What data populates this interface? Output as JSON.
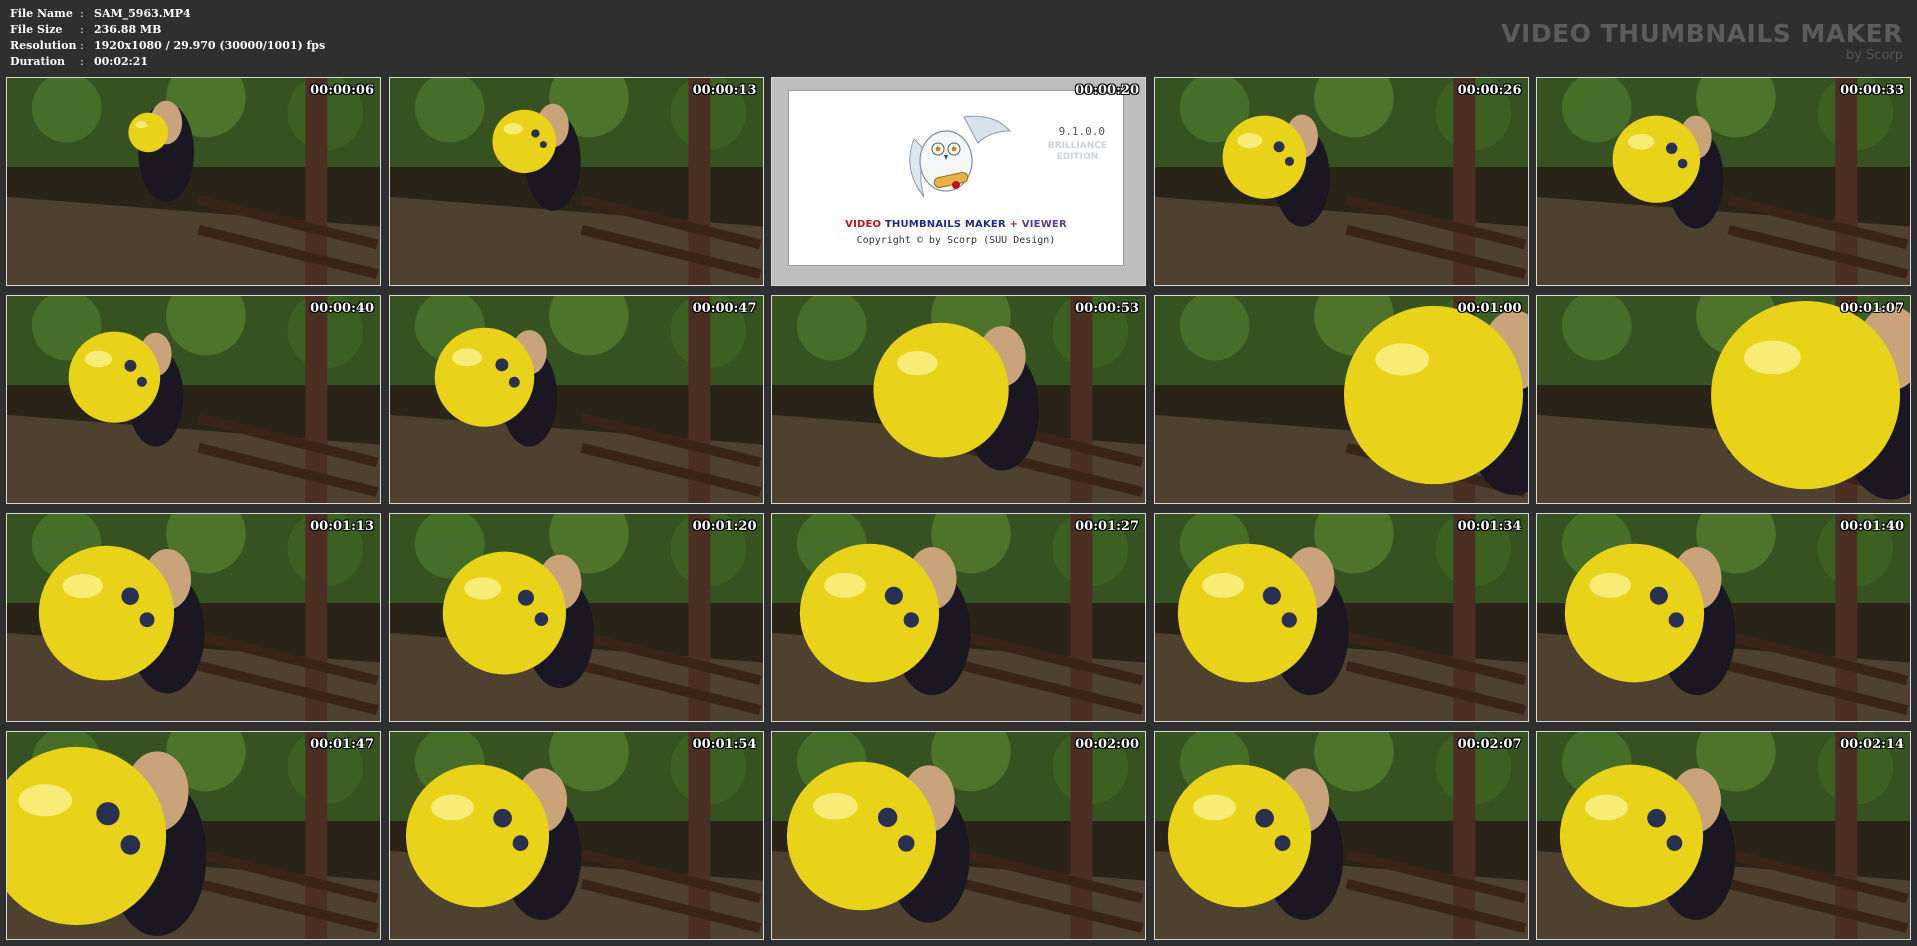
{
  "info": {
    "rows": [
      {
        "label": "File Name",
        "sep": ":",
        "value": "SAM_5963.MP4"
      },
      {
        "label": "File Size",
        "sep": ":",
        "value": "236.88 MB"
      },
      {
        "label": "Resolution",
        "sep": ":",
        "value": "1920x1080 / 29.970 (30000/1001) fps"
      },
      {
        "label": "Duration",
        "sep": ":",
        "value": "00:02:21"
      }
    ]
  },
  "brand": {
    "title": "VIDEO THUMBNAILS MAKER",
    "subtitle": "by Scorp"
  },
  "splash": {
    "version": "9.1.0.0",
    "edition_line1": "BRILLIANCE",
    "edition_line2": "EDITION",
    "name_video": "VIDEO",
    "name_mid": " THUMBNAILS MAKER ",
    "name_plus": "+",
    "name_viewer": " VIEWER",
    "copyright": "Copyright © by Scorp (SUU Design)"
  },
  "thumbnails": [
    {
      "time": "00:00:06",
      "kind": "scene"
    },
    {
      "time": "00:00:13",
      "kind": "scene"
    },
    {
      "time": "00:00:20",
      "kind": "splash"
    },
    {
      "time": "00:00:26",
      "kind": "scene"
    },
    {
      "time": "00:00:33",
      "kind": "scene"
    },
    {
      "time": "00:00:40",
      "kind": "scene"
    },
    {
      "time": "00:00:47",
      "kind": "scene"
    },
    {
      "time": "00:00:53",
      "kind": "scene"
    },
    {
      "time": "00:01:00",
      "kind": "scene"
    },
    {
      "time": "00:01:07",
      "kind": "scene"
    },
    {
      "time": "00:01:13",
      "kind": "scene"
    },
    {
      "time": "00:01:20",
      "kind": "scene"
    },
    {
      "time": "00:01:27",
      "kind": "scene"
    },
    {
      "time": "00:01:34",
      "kind": "scene"
    },
    {
      "time": "00:01:40",
      "kind": "scene"
    },
    {
      "time": "00:01:47",
      "kind": "scene"
    },
    {
      "time": "00:01:54",
      "kind": "scene"
    },
    {
      "time": "00:02:00",
      "kind": "scene"
    },
    {
      "time": "00:02:07",
      "kind": "scene"
    },
    {
      "time": "00:02:14",
      "kind": "scene"
    }
  ],
  "colors": {
    "background": "#2f2f2f",
    "balloon": "#e8d21a",
    "foliage": "#3b5a22",
    "wood": "#4a2f22"
  }
}
